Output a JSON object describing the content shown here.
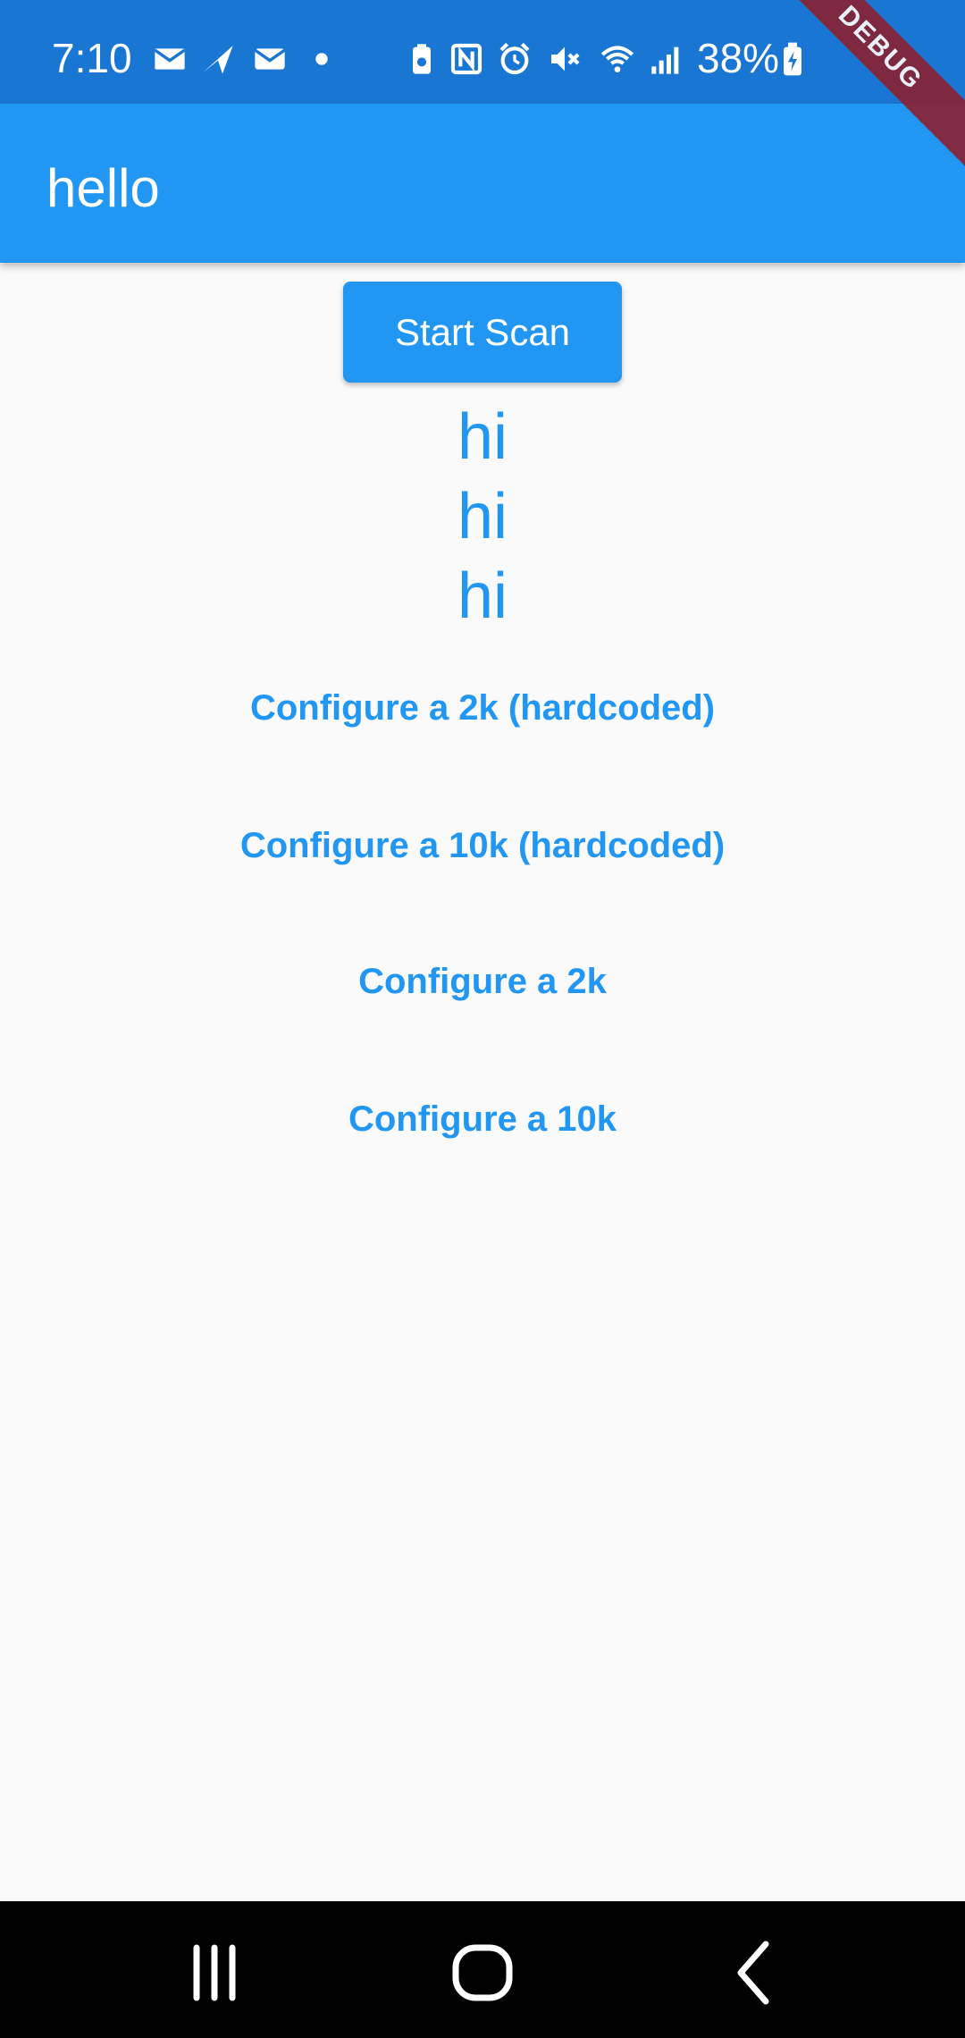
{
  "status_bar": {
    "time": "7:10",
    "battery": "38%",
    "icons": [
      "mail-icon",
      "send-icon",
      "mail-icon",
      "dot-icon",
      "battery-saver-icon",
      "nfc-icon",
      "alarm-icon",
      "mute-icon",
      "wifi-icon",
      "signal-icon",
      "battery-charging-icon"
    ]
  },
  "debug_banner": "DEBUG",
  "app_bar": {
    "title": "hello"
  },
  "main": {
    "start_scan_label": "Start Scan",
    "hi_lines": [
      "hi",
      "hi",
      "hi"
    ],
    "configure_buttons": [
      "Configure a 2k (hardcoded)",
      "Configure a 10k (hardcoded)",
      "Configure a 2k",
      "Configure a 10k"
    ]
  },
  "nav_bar": {
    "icons": [
      "recent-apps-icon",
      "home-icon",
      "back-icon"
    ]
  },
  "colors": {
    "primary": "#2196f3",
    "status_bar": "#1976d2",
    "background": "#fafafa"
  }
}
